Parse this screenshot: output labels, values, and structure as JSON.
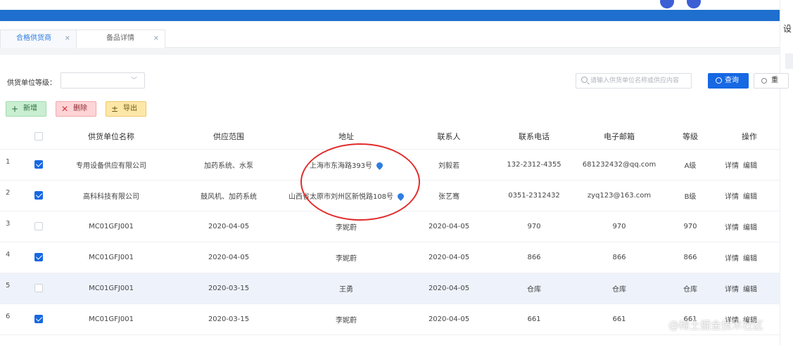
{
  "tabs": [
    {
      "label": "合格供货商",
      "close": "×"
    },
    {
      "label": "备品详情",
      "close": "×"
    }
  ],
  "filter": {
    "label": "供货单位等级：",
    "select_value": "",
    "chevron": "﹀"
  },
  "search": {
    "placeholder": "请输入供货单位名称或供应内容"
  },
  "buttons": {
    "query": "查询",
    "reset": "重",
    "add": "新增",
    "delete": "删除",
    "export": "导出"
  },
  "icons": {
    "add": "+",
    "delete": "✕",
    "export": "±"
  },
  "side": {
    "char": "设"
  },
  "table": {
    "headers": [
      "供货单位名称",
      "供应范围",
      "地址",
      "联系人",
      "联系电话",
      "电子邮箱",
      "等级",
      "操作"
    ],
    "rows": [
      {
        "idx": "1",
        "checked": true,
        "name": "专用设备供应有限公司",
        "scope": "加药系统、水泵",
        "address": "上海市东海路393号",
        "pin": true,
        "contact": "刘毅若",
        "phone": "132-2312-4355",
        "email": "681232432@qq.com",
        "level": "A级",
        "detail": "详情",
        "edit": "编辑"
      },
      {
        "idx": "2",
        "checked": true,
        "name": "高科科技有限公司",
        "scope": "鼓风机、加药系统",
        "address": "山西省太原市刘州区新悦路108号",
        "pin": true,
        "contact": "张艺骞",
        "phone": "0351-2312432",
        "email": "zyq123@163.com",
        "level": "B级",
        "detail": "详情",
        "edit": "编辑"
      },
      {
        "idx": "3",
        "checked": false,
        "name": "MC01GFJ001",
        "scope": "2020-04-05",
        "address": "李妮蔚",
        "pin": false,
        "contact": "2020-04-05",
        "phone": "970",
        "email": "970",
        "level": "970",
        "detail": "详情",
        "edit": "编辑"
      },
      {
        "idx": "4",
        "checked": true,
        "name": "MC01GFJ001",
        "scope": "2020-04-05",
        "address": "李妮蔚",
        "pin": false,
        "contact": "2020-04-05",
        "phone": "866",
        "email": "866",
        "level": "866",
        "detail": "详情",
        "edit": "编辑"
      },
      {
        "idx": "5",
        "checked": false,
        "name": "MC01GFJ001",
        "scope": "2020-03-15",
        "address": "王勇",
        "pin": false,
        "contact": "2020-04-05",
        "phone": "仓库",
        "email": "仓库",
        "level": "仓库",
        "detail": "详情",
        "edit": "编辑"
      },
      {
        "idx": "6",
        "checked": true,
        "name": "MC01GFJ001",
        "scope": "2020-03-15",
        "address": "李妮蔚",
        "pin": false,
        "contact": "2020-04-05",
        "phone": "661",
        "email": "661",
        "level": "661",
        "detail": "详情",
        "edit": "编辑"
      }
    ]
  },
  "watermark": "@稀土掘金技术社区",
  "colors": {
    "primary": "#1668e3",
    "topbar": "#1e6fce",
    "annotation": "#e12b2b"
  }
}
